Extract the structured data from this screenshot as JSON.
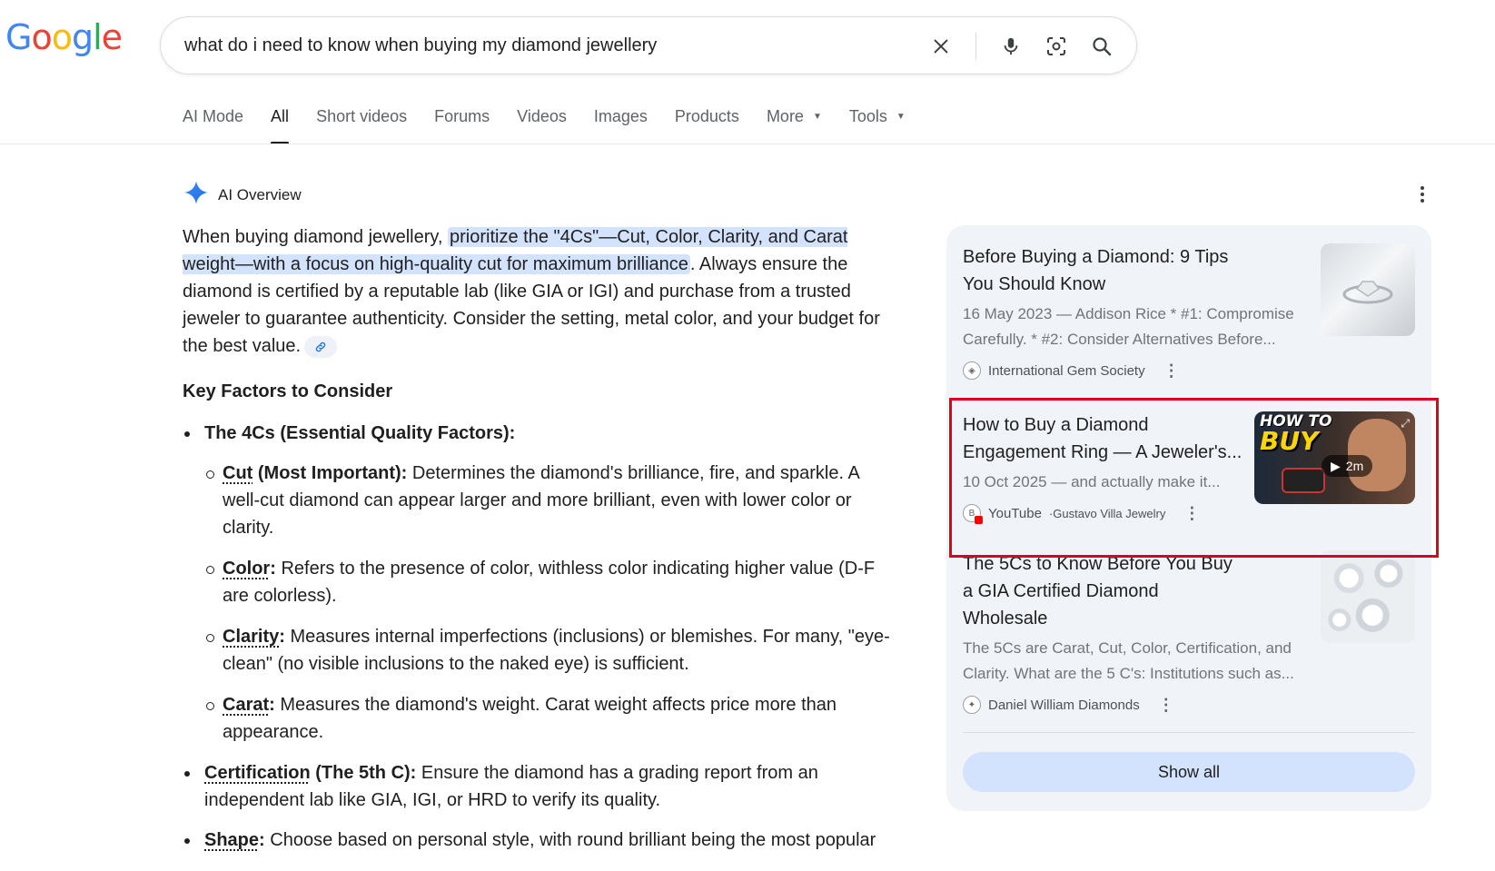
{
  "logo": {
    "letters": [
      "G",
      "o",
      "o",
      "g",
      "l",
      "e"
    ],
    "colors": [
      "#4285F4",
      "#EA4335",
      "#FBBC05",
      "#4285F4",
      "#34A853",
      "#EA4335"
    ]
  },
  "search": {
    "query": "what do i need to know when buying my diamond jewellery"
  },
  "tabs": [
    {
      "label": "AI Mode"
    },
    {
      "label": "All",
      "active": true
    },
    {
      "label": "Short videos"
    },
    {
      "label": "Forums"
    },
    {
      "label": "Videos"
    },
    {
      "label": "Images"
    },
    {
      "label": "Products"
    },
    {
      "label": "More",
      "dropdown": true
    },
    {
      "label": "Tools",
      "dropdown": true
    }
  ],
  "ai_overview": {
    "title": "AI Overview",
    "intro_pre": "When buying diamond jewellery, ",
    "intro_highlight": "prioritize the \"4Cs\"—Cut, Color, Clarity, and Carat weight—with a focus on high-quality cut for maximum brilliance",
    "intro_post": ". Always ensure the diamond is certified by a reputable lab (like GIA or IGI) and purchase from a trusted jeweler to guarantee authenticity. Consider the setting, metal color, and your budget for the best value.",
    "key_heading": "Key Factors to Consider",
    "fourcs_heading": "The 4Cs (Essential Quality Factors):",
    "subitems": [
      {
        "term": "Cut",
        "term_suffix": " (Most Important):",
        "text": " Determines the diamond's brilliance, fire, and sparkle. A well-cut diamond can appear larger and more brilliant, even with lower color or clarity."
      },
      {
        "term": "Color",
        "term_suffix": ":",
        "text": " Refers to the presence of color, withless color indicating higher value (D-F are colorless)."
      },
      {
        "term": "Clarity",
        "term_suffix": ":",
        "text": " Measures internal imperfections (inclusions) or blemishes. For many, \"eye-clean\" (no visible inclusions to the naked eye) is sufficient."
      },
      {
        "term": "Carat",
        "term_suffix": ":",
        "text": " Measures the diamond's weight. Carat weight affects price more than appearance."
      }
    ],
    "cert_term": "Certification",
    "cert_suffix": " (The 5th C):",
    "cert_text": " Ensure the diamond has a grading report from an independent lab like GIA, IGI, or HRD to verify its quality.",
    "shape_term": "Shape",
    "shape_suffix": ":",
    "shape_text": " Choose based on personal style, with round brilliant being the most popular"
  },
  "sources": [
    {
      "title": "Before Buying a Diamond: 9 Tips You Should Know",
      "snippet": "16 May 2023 — Addison Rice * #1: Compromise Carefully. * #2: Consider Alternatives Before...",
      "site": "International Gem Society"
    },
    {
      "title": "How to Buy a Diamond Engagement Ring — A Jeweler's...",
      "snippet": "10 Oct 2025 — and actually make it...",
      "site": "YouTube",
      "site_sep": " · ",
      "channel": "Gustavo Villa Jewelry",
      "thumb_line1": "HOW TO",
      "thumb_line2": "BUY",
      "duration": "2m"
    },
    {
      "title": "The 5Cs to Know Before You Buy a GIA Certified Diamond Wholesale",
      "snippet": "The 5Cs are Carat, Cut, Color, Certification, and Clarity. What are the 5 C's: Institutions such as...",
      "site": "Daniel William Diamonds"
    }
  ],
  "show_all": "Show all"
}
